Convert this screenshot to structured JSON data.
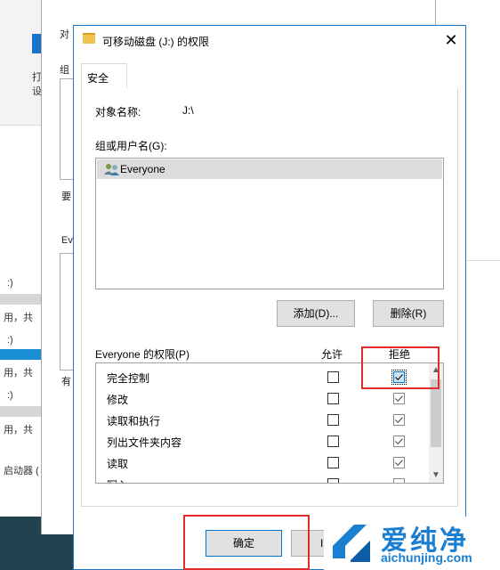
{
  "background": {
    "left_fragments": [
      ":)",
      "用，共",
      ":)",
      "用，共",
      ":)",
      "用，共",
      "启动器 ("
    ],
    "top_left_labels": [
      "打",
      "设"
    ]
  },
  "parent_dialog": {
    "fragments": [
      "对",
      "组",
      "要",
      "Ev",
      "有"
    ]
  },
  "dialog": {
    "title": "可移动磁盘 (J:) 的权限",
    "close_glyph": "✕",
    "tab_security": "安全",
    "object_name_label": "对象名称:",
    "object_name_value": "J:\\",
    "groups_label": "组或用户名(G):",
    "users": [
      "Everyone"
    ],
    "add_button": "添加(D)...",
    "remove_button": "删除(R)",
    "permissions_label": "Everyone 的权限(P)",
    "allow_header": "允许",
    "deny_header": "拒绝",
    "permissions": [
      {
        "name": "完全控制",
        "allow": false,
        "deny": true
      },
      {
        "name": "修改",
        "allow": false,
        "deny": true
      },
      {
        "name": "读取和执行",
        "allow": false,
        "deny": true
      },
      {
        "name": "列出文件夹内容",
        "allow": false,
        "deny": true
      },
      {
        "name": "读取",
        "allow": false,
        "deny": true
      },
      {
        "name": "写入",
        "allow": false,
        "deny": true
      }
    ],
    "ok_button": "确定",
    "cancel_button_partial": "I"
  },
  "watermark": {
    "brand_cn": "爱纯净",
    "brand_url": "aichunjing.com"
  },
  "colors": {
    "accent_blue": "#1e74c8",
    "highlight_red": "#e12a2a",
    "taskbar": "#20434f"
  }
}
